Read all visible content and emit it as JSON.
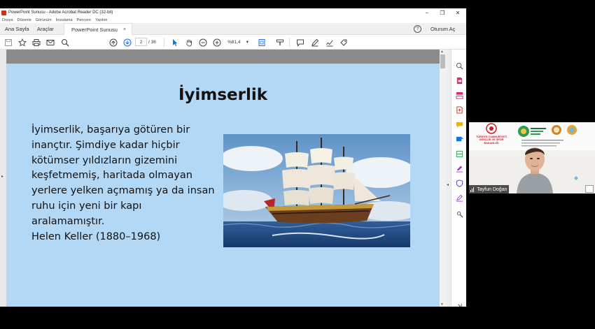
{
  "window": {
    "title": "PowerPoint Sunusu - Adobe Acrobat Reader DC (32-bit)",
    "minimize": "−",
    "maximize": "❐",
    "close": "✕"
  },
  "menu": [
    "Dosya",
    "Düzenle",
    "Görünüm",
    "İmzalama",
    "Pencere",
    "Yardım"
  ],
  "tabs": {
    "home": "Ana Sayfa",
    "tools": "Araçlar",
    "document": "PowerPoint Sunusu",
    "close": "×",
    "help": "?",
    "signin": "Oturum Aç"
  },
  "toolbar": {
    "current_page": "2",
    "total_pages": "/ 36",
    "zoom": "%81,4",
    "zoom_caret": "▾"
  },
  "slide": {
    "title": "İyimserlik",
    "body_lines": [
      "İyimserlik, başarıya götüren bir",
      "inançtır. Şimdiye kadar hiçbir",
      "kötümser yıldızların gizemini",
      "keşfetmemiş, haritada olmayan",
      "yerlere yelken açmamış ya da insan",
      "ruhu için yeni bir kapı",
      "aralamamıştır.",
      "Helen Keller (1880–1968)"
    ]
  },
  "video": {
    "participant_name": "Tayfun Doğan",
    "banner_text": [
      "TÜRKİYE CUMHURİYETİ",
      "GENÇLİK VE SPOR",
      "BAKANLIĞI"
    ]
  },
  "colors": {
    "slide_bg": "#b3d8f5",
    "adobe_red": "#d4291c",
    "icon_blue": "#1473e6",
    "tool_pink": "#e0296a",
    "tool_green": "#2d9d4d",
    "tool_orange": "#e68619"
  }
}
